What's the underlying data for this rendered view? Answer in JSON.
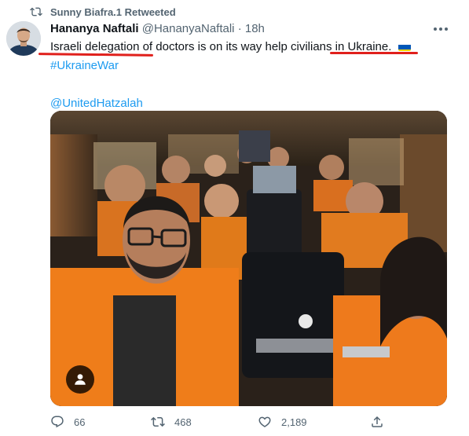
{
  "retweet_context": {
    "text": "Sunny Biafra.1 Retweeted",
    "icon": "retweet-icon"
  },
  "tweet": {
    "author_name": "Hananya Naftali",
    "author_handle": "@HananyaNaftali",
    "separator": "·",
    "timestamp": "18h",
    "text_line1": "Israeli delegation of doctors is on its way help civilians in Ukraine.",
    "flag": "Ukraine flag",
    "hashtag": "#UkraineWar",
    "mention": "@UnitedHatzalah",
    "highlight_color": "#e0201c",
    "link_color": "#1d9bf0"
  },
  "actions": {
    "replies": "66",
    "retweets": "468",
    "likes": "2,189"
  }
}
